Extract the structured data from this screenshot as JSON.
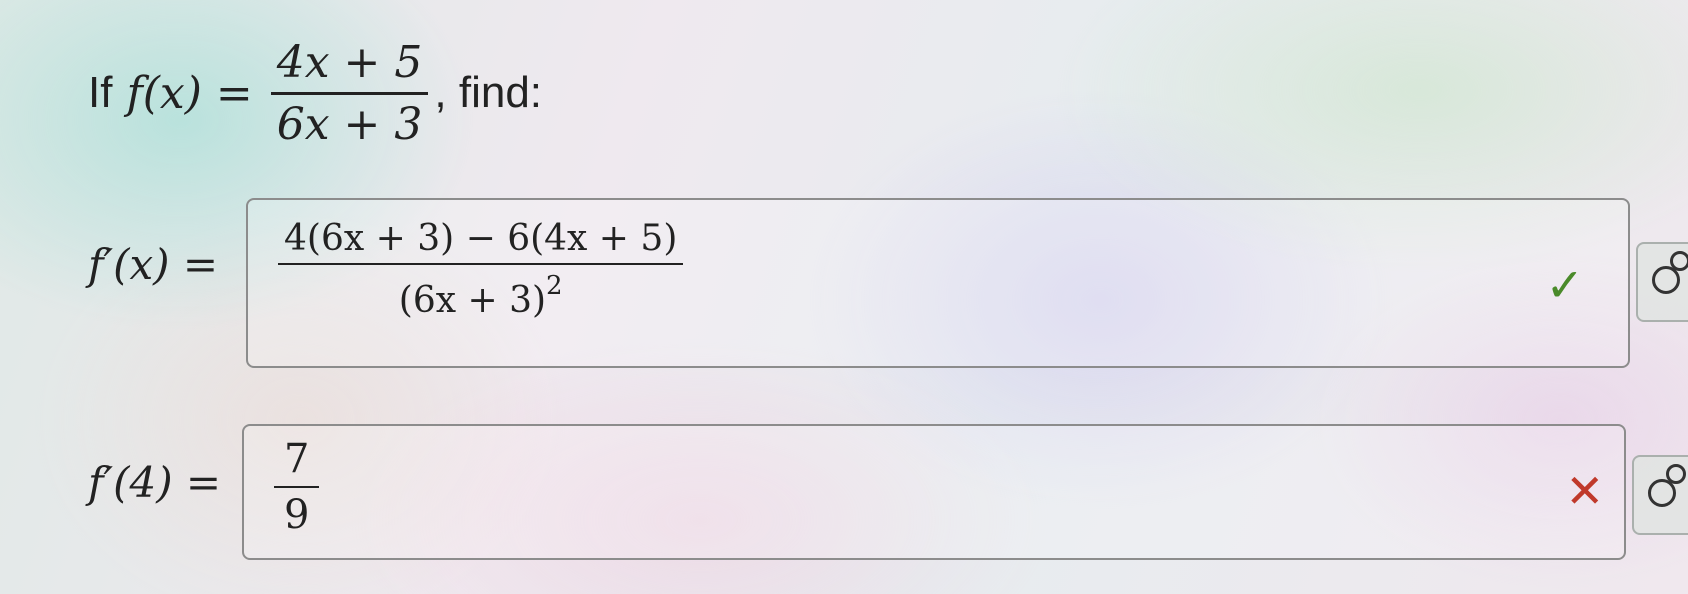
{
  "question": {
    "prefix": "If",
    "func": "f(x) =",
    "numerator": "4x + 5",
    "denominator": "6x + 3",
    "suffix": ", find:"
  },
  "derivative_row": {
    "label": "f′(x) =",
    "answer_numerator": "4(6x + 3) − 6(4x + 5)",
    "answer_denominator_base": "(6x + 3)",
    "answer_denominator_exponent": "2",
    "status": "correct",
    "status_icon": "check-icon",
    "status_color": "#4a8a2a"
  },
  "value_row": {
    "label": "f′(4) =",
    "answer_numerator": "7",
    "answer_denominator": "9",
    "status": "incorrect",
    "status_icon": "cross-icon",
    "status_color": "#c0392b"
  },
  "side_buttons": {
    "icon": "link-rings-icon"
  }
}
